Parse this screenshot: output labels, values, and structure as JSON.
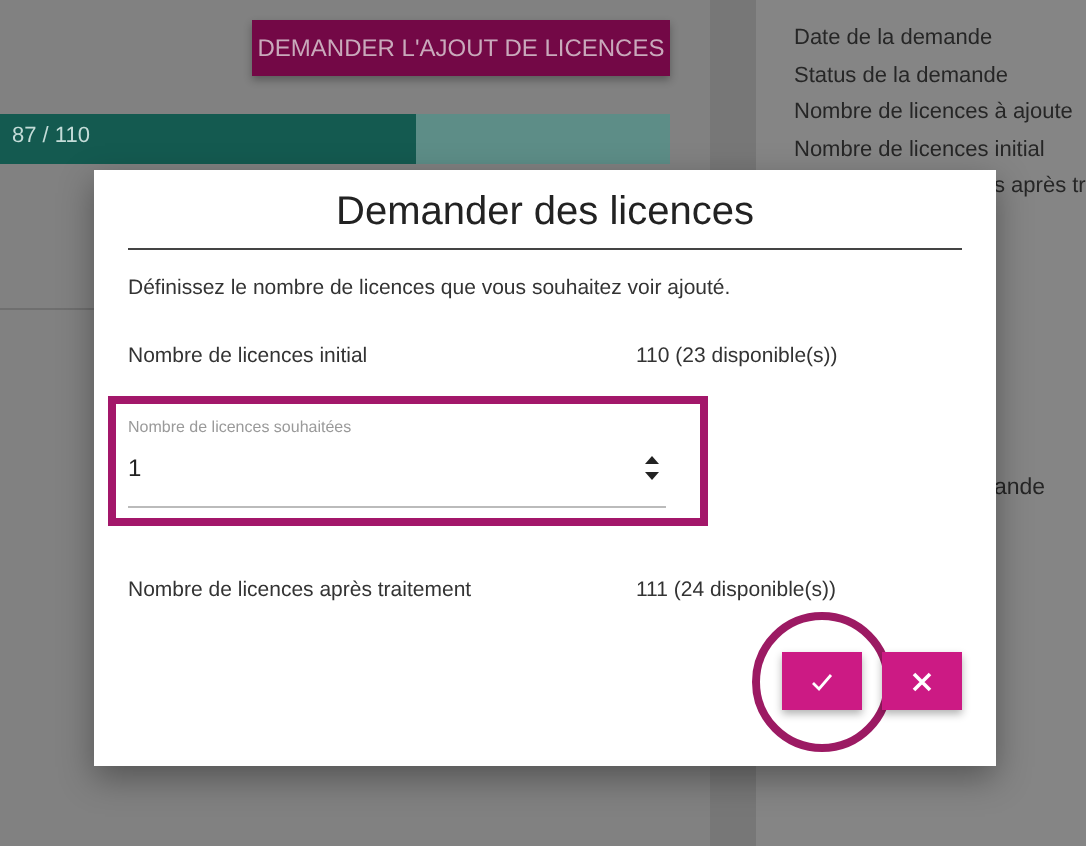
{
  "background": {
    "action_button": {
      "label": "DEMANDER L'AJOUT DE LICENCES"
    },
    "progress": {
      "label": "87 / 110",
      "level": 0.62
    },
    "details": [
      "Date de la demande",
      "Status de la demande",
      "Nombre de licences à ajoute",
      "Nombre de licences initial",
      "s après tr"
    ],
    "partial_text": "ande"
  },
  "dialog": {
    "title": "Demander des licences",
    "description": "Définissez le nombre de licences que vous souhaitez voir ajouté.",
    "initial": {
      "label": "Nombre de licences initial",
      "value": "110 (23 disponible(s))"
    },
    "field": {
      "label": "Nombre de licences souhaitées",
      "value": "1",
      "highlighted": true
    },
    "after": {
      "label": "Nombre de licences après traitement",
      "value": "111 (24 disponible(s))"
    },
    "buttons": [
      {
        "kind": "confirm",
        "highlighted": true
      },
      {
        "kind": "cancel",
        "highlighted": false
      }
    ]
  }
}
